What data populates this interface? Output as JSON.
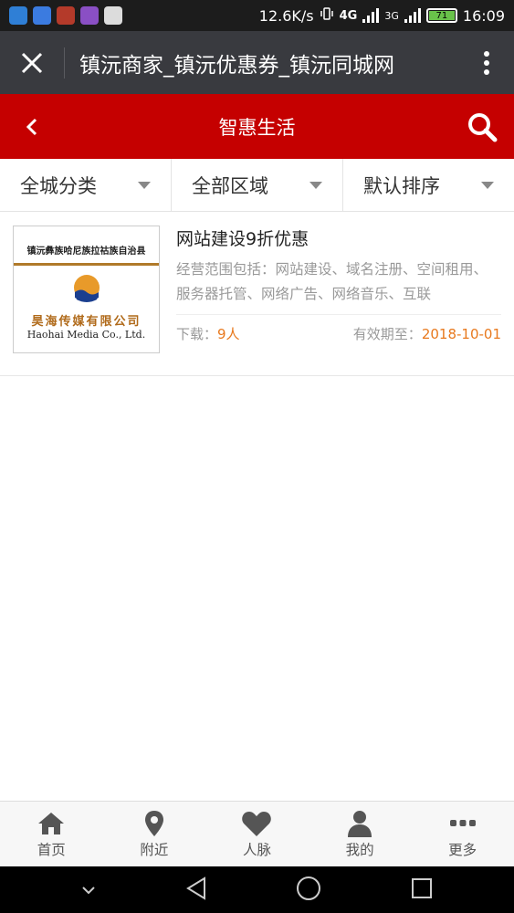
{
  "status_bar": {
    "speed": "12.6K/s",
    "network_4g": "4G",
    "network_3g": "3G",
    "battery": "71",
    "time": "16:09"
  },
  "title_bar": {
    "title": "镇沅商家_镇沅优惠券_镇沅同城网"
  },
  "header": {
    "title": "智惠生活"
  },
  "filters": [
    {
      "label": "全城分类"
    },
    {
      "label": "全部区域"
    },
    {
      "label": "默认排序"
    }
  ],
  "listing": {
    "thumb_top_text": "镇沅彝族哈尼族拉祜族自治县",
    "thumb_company_cn": "昊海传媒有限公司",
    "thumb_company_en": "Haohai Media Co., Ltd.",
    "title": "网站建设9折优惠",
    "description": "经营范围包括：网站建设、域名注册、空间租用、服务器托管、网络广告、网络音乐、互联",
    "downloads_label": "下载：",
    "downloads_value": "9人",
    "expiry_label": "有效期至：",
    "expiry_value": "2018-10-01"
  },
  "bottom_nav": [
    {
      "label": "首页",
      "icon": "home-icon"
    },
    {
      "label": "附近",
      "icon": "location-pin-icon"
    },
    {
      "label": "人脉",
      "icon": "heart-icon"
    },
    {
      "label": "我的",
      "icon": "user-icon"
    },
    {
      "label": "更多",
      "icon": "more-dots-icon"
    }
  ],
  "colors": {
    "header_red": "#c50000",
    "title_bar": "#393a3f",
    "accent_orange": "#e8791e"
  }
}
